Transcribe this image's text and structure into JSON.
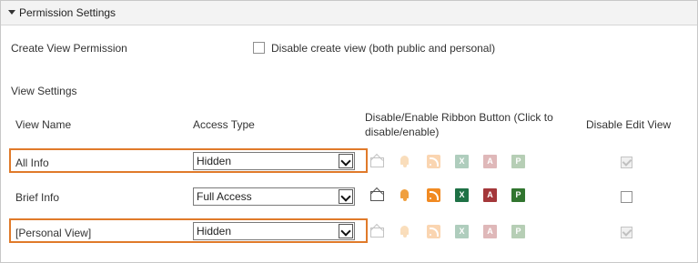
{
  "section": {
    "title": "Permission Settings"
  },
  "create_view": {
    "label": "Create View Permission",
    "checkbox_label": "Disable create view (both public and personal)"
  },
  "view_settings": {
    "label": "View Settings"
  },
  "columns": {
    "view_name": "View Name",
    "access_type": "Access Type",
    "ribbon": "Disable/Enable Ribbon Button (Click to disable/enable)",
    "ribbon_line1": "Disable/Enable Ribbon Button (Click to",
    "ribbon_line2": "disable/enable)",
    "disable_edit": "Disable Edit View"
  },
  "rows": [
    {
      "name": "All Info",
      "access": "Hidden",
      "ribbon_enabled": false,
      "edit_disabled": true,
      "edit_checkbox_enabled": false
    },
    {
      "name": "Brief Info",
      "access": "Full Access",
      "ribbon_enabled": true,
      "edit_disabled": false,
      "edit_checkbox_enabled": true
    },
    {
      "name": "[Personal View]",
      "access": "Hidden",
      "ribbon_enabled": false,
      "edit_disabled": true,
      "edit_checkbox_enabled": false
    }
  ],
  "ribbon_icons": [
    "email-icon",
    "alert-bell-icon",
    "rss-feed-icon",
    "excel-export-icon",
    "access-icon",
    "project-icon"
  ],
  "icon_glyphs": {
    "excel": "X",
    "access": "A",
    "project": "P"
  },
  "colors": {
    "highlight": "#e07a2a",
    "header_bg": "#f3f3f3"
  }
}
